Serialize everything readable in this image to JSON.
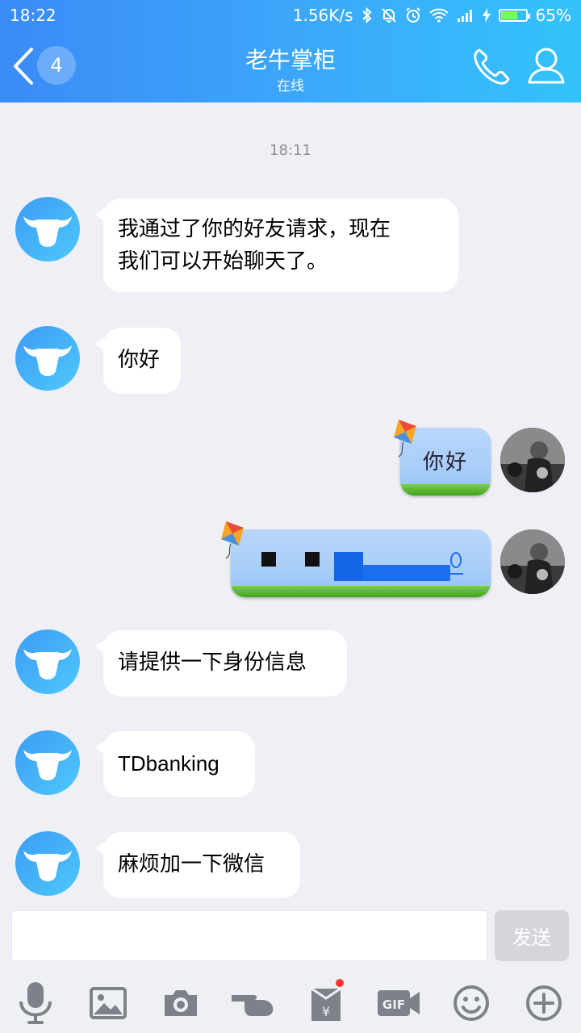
{
  "status_bar": {
    "time": "18:22",
    "network_speed": "1.56K/s",
    "battery": "65%",
    "icons": [
      "bluetooth-icon",
      "mute-icon",
      "alarm-icon",
      "wifi-icon",
      "signal-icon",
      "charging-icon",
      "battery-icon"
    ]
  },
  "header": {
    "back_icon": "chevron-left-icon",
    "unread_count": "4",
    "title": "老牛掌柜",
    "subtitle": "在线",
    "actions": [
      "phone-icon",
      "profile-icon"
    ],
    "gradient": [
      "#3b8bf6",
      "#33c3fb"
    ]
  },
  "chat": {
    "timestamp": "18:11",
    "messages": [
      {
        "from": "contact",
        "lines": [
          "我通过了你的好友请求，现在",
          "我们可以开始聊天了。"
        ]
      },
      {
        "from": "contact",
        "lines": [
          "你好"
        ]
      },
      {
        "from": "me",
        "style": "kite-bubble",
        "text": "你好"
      },
      {
        "from": "me",
        "style": "kite-bubble",
        "text": "",
        "redacted": true
      },
      {
        "from": "contact",
        "lines": [
          "请提供一下身份信息"
        ]
      },
      {
        "from": "contact",
        "lines": [
          "TDbanking"
        ]
      },
      {
        "from": "contact",
        "lines": [
          "麻烦加一下微信"
        ]
      }
    ]
  },
  "input_bar": {
    "placeholder": "",
    "send_label": "发送"
  },
  "toolbar": {
    "items": [
      "microphone-icon",
      "image-icon",
      "camera-icon",
      "poke-icon",
      "red-packet-icon",
      "gif-icon",
      "emoji-icon",
      "plus-icon"
    ],
    "red_packet_has_dot": true
  }
}
